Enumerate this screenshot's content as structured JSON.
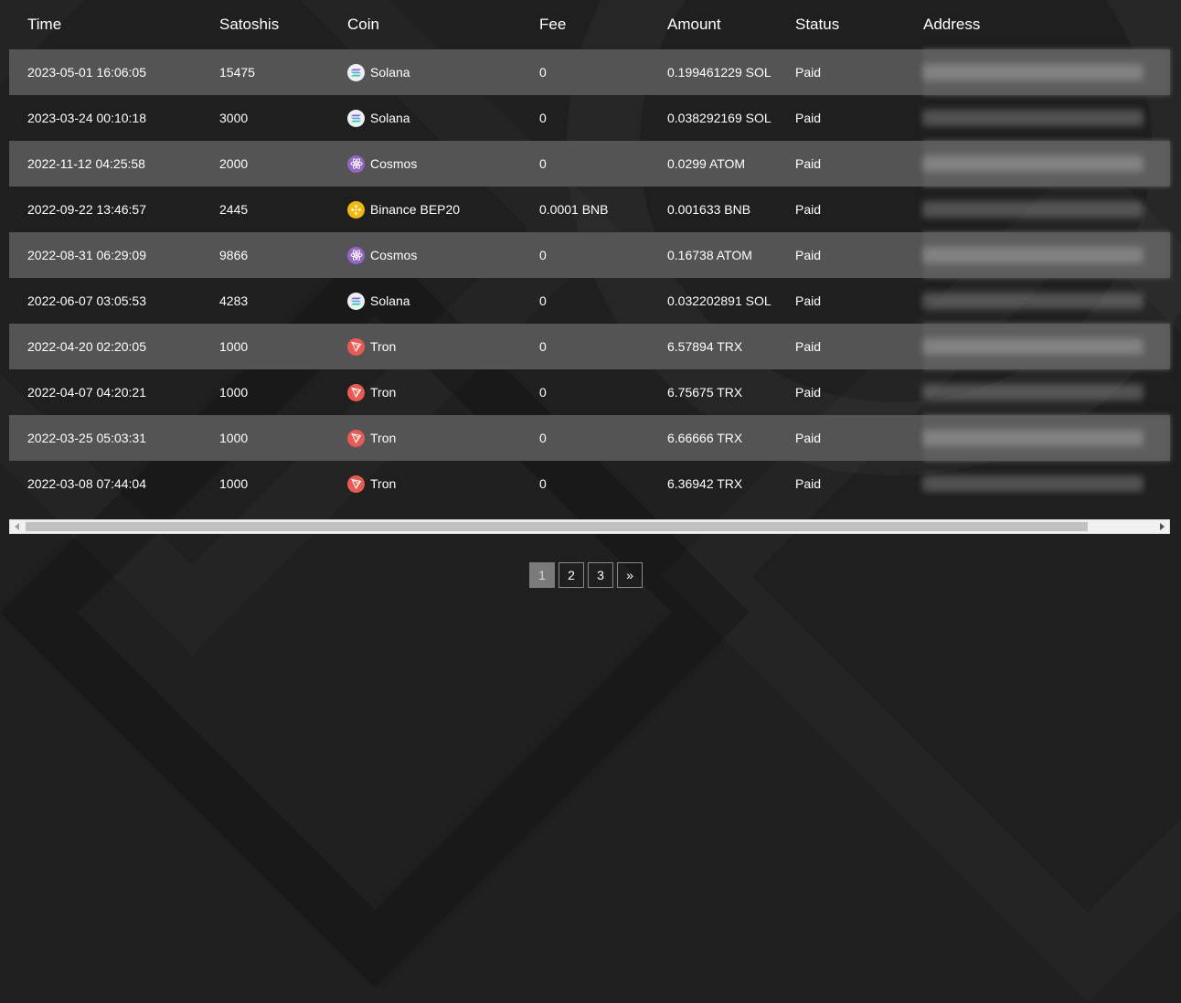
{
  "headers": {
    "time": "Time",
    "satoshis": "Satoshis",
    "coin": "Coin",
    "fee": "Fee",
    "amount": "Amount",
    "status": "Status",
    "address": "Address"
  },
  "rows": [
    {
      "time": "2023-05-01 16:06:05",
      "satoshis": "15475",
      "coin": "Solana",
      "coin_icon": "solana-icon",
      "fee": "0",
      "amount": "0.199461229 SOL",
      "status": "Paid"
    },
    {
      "time": "2023-03-24 00:10:18",
      "satoshis": "3000",
      "coin": "Solana",
      "coin_icon": "solana-icon",
      "fee": "0",
      "amount": "0.038292169 SOL",
      "status": "Paid"
    },
    {
      "time": "2022-11-12 04:25:58",
      "satoshis": "2000",
      "coin": "Cosmos",
      "coin_icon": "cosmos-icon",
      "fee": "0",
      "amount": "0.0299 ATOM",
      "status": "Paid"
    },
    {
      "time": "2022-09-22 13:46:57",
      "satoshis": "2445",
      "coin": "Binance BEP20",
      "coin_icon": "binance-icon",
      "fee": "0.0001 BNB",
      "amount": "0.001633 BNB",
      "status": "Paid"
    },
    {
      "time": "2022-08-31 06:29:09",
      "satoshis": "9866",
      "coin": "Cosmos",
      "coin_icon": "cosmos-icon",
      "fee": "0",
      "amount": "0.16738 ATOM",
      "status": "Paid"
    },
    {
      "time": "2022-06-07 03:05:53",
      "satoshis": "4283",
      "coin": "Solana",
      "coin_icon": "solana-icon",
      "fee": "0",
      "amount": "0.032202891 SOL",
      "status": "Paid"
    },
    {
      "time": "2022-04-20 02:20:05",
      "satoshis": "1000",
      "coin": "Tron",
      "coin_icon": "tron-icon",
      "fee": "0",
      "amount": "6.57894 TRX",
      "status": "Paid"
    },
    {
      "time": "2022-04-07 04:20:21",
      "satoshis": "1000",
      "coin": "Tron",
      "coin_icon": "tron-icon",
      "fee": "0",
      "amount": "6.75675 TRX",
      "status": "Paid"
    },
    {
      "time": "2022-03-25 05:03:31",
      "satoshis": "1000",
      "coin": "Tron",
      "coin_icon": "tron-icon",
      "fee": "0",
      "amount": "6.66666 TRX",
      "status": "Paid"
    },
    {
      "time": "2022-03-08 07:44:04",
      "satoshis": "1000",
      "coin": "Tron",
      "coin_icon": "tron-icon",
      "fee": "0",
      "amount": "6.36942 TRX",
      "status": "Paid"
    }
  ],
  "pagination": {
    "pages": [
      "1",
      "2",
      "3"
    ],
    "current": "1",
    "next_label": "»"
  },
  "colors": {
    "background": "#1f1f1f",
    "row_stripe": "#545454",
    "solana": "#eef0f2",
    "cosmos": "#9464c6",
    "binance": "#f0b90b",
    "tron": "#ea5a52"
  }
}
